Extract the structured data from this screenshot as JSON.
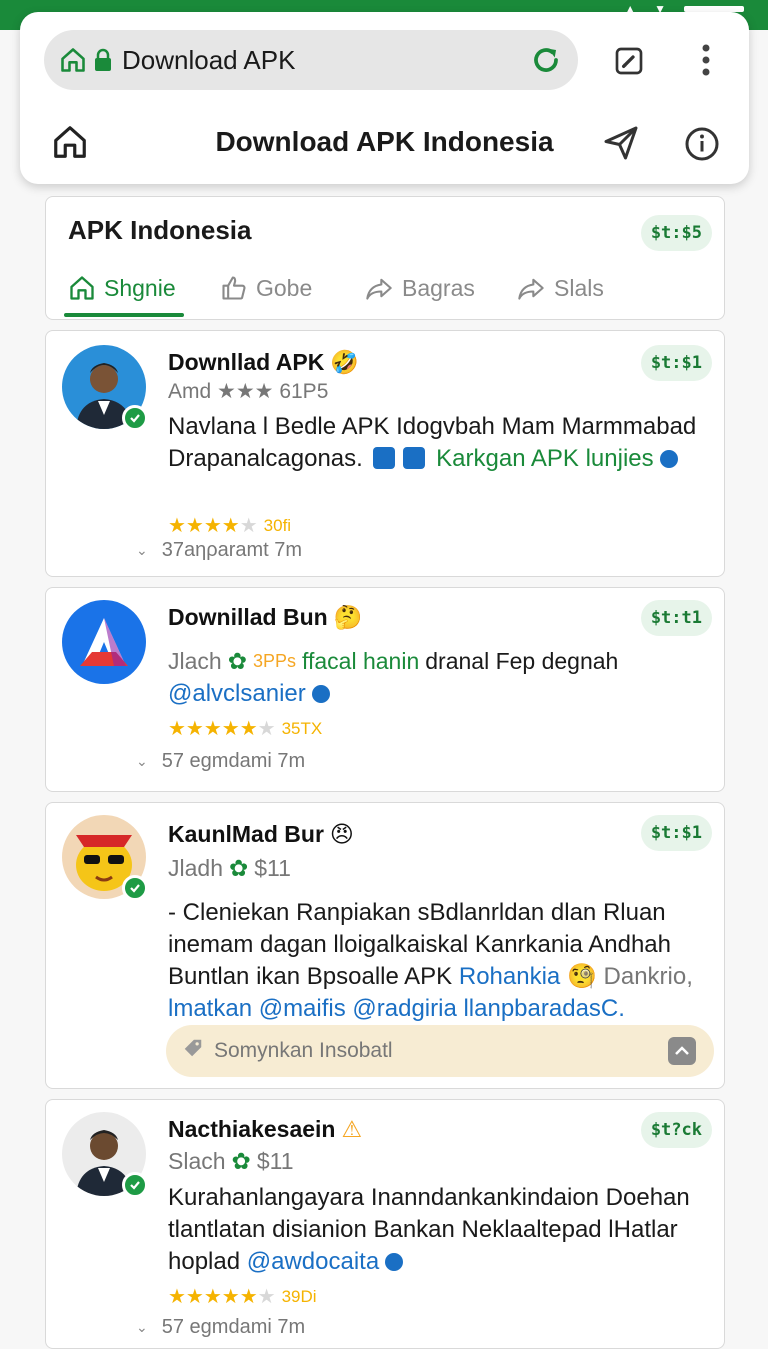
{
  "browser": {
    "url_text": "Download APK"
  },
  "nav": {
    "title": "Download APK Indonesia"
  },
  "section": {
    "title": "APK Indonesia",
    "badge": "$t:$5",
    "tabs": [
      {
        "label": "Shgnie",
        "active": true
      },
      {
        "label": "Gobe",
        "active": false
      },
      {
        "label": "Bagras",
        "active": false
      },
      {
        "label": "Slals",
        "active": false
      }
    ]
  },
  "posts": [
    {
      "name": "Downllad APK",
      "name_emoji": "🤣",
      "meta": "Amd ★★★ 61P5",
      "badge": "$t:$1",
      "body_1": "Navlana l Bedle APK Idogvbah Mam Marmmabad Drapanalcagonas.",
      "body_link": "Karkgan APK lunjies",
      "rating_count": "30fi",
      "time": "37aηρaramt 7m"
    },
    {
      "name": "Downillad Bun",
      "name_emoji": "🤔",
      "meta_prefix": "Jlach",
      "meta_tag": "3PPs",
      "meta_green": "ffacal hanin",
      "meta_rest": "dranal Fep degnah",
      "handle": "@alvclsanier",
      "badge": "$t:t1",
      "rating_count": "35TX",
      "time": "57 egmdami 7m"
    },
    {
      "name": "KaunlMad Bur",
      "name_emoji": "😠",
      "meta_prefix": "Jladh",
      "meta_tag": "$11",
      "badge": "$t:$1",
      "body_1": "- Cleniekan Ranpiakan sBdlanrldan dlan Rluan inemam dagan lloigalkaiskal Kanrkania Andhah Buntlan ikan Bpsoalle APK",
      "body_link": "Rohankia",
      "body_emoji": "🧐",
      "body_2": "Dankrio,",
      "body_tail": "lmatkan @maifis @radgiria llanpbaradasC.",
      "comment_placeholder": "Somynkan Insobatl"
    },
    {
      "name": "Nacthiakesaein",
      "name_emoji": "⚠",
      "meta_prefix": "Slach",
      "meta_tag": "$11",
      "badge": "$t?ck",
      "body_1": "Kurahanlangayara Inanndankankindaion Doehan tlantlatan disianion Bankan Neklaaltepad lHatlar hoplad",
      "handle": "@awdocaita",
      "rating_count": "39Di",
      "time": "57 egmdami 7m"
    }
  ],
  "colors": {
    "brand_green": "#1a8a3a",
    "link_blue": "#1a6fc4",
    "star_yellow": "#f5b301"
  }
}
